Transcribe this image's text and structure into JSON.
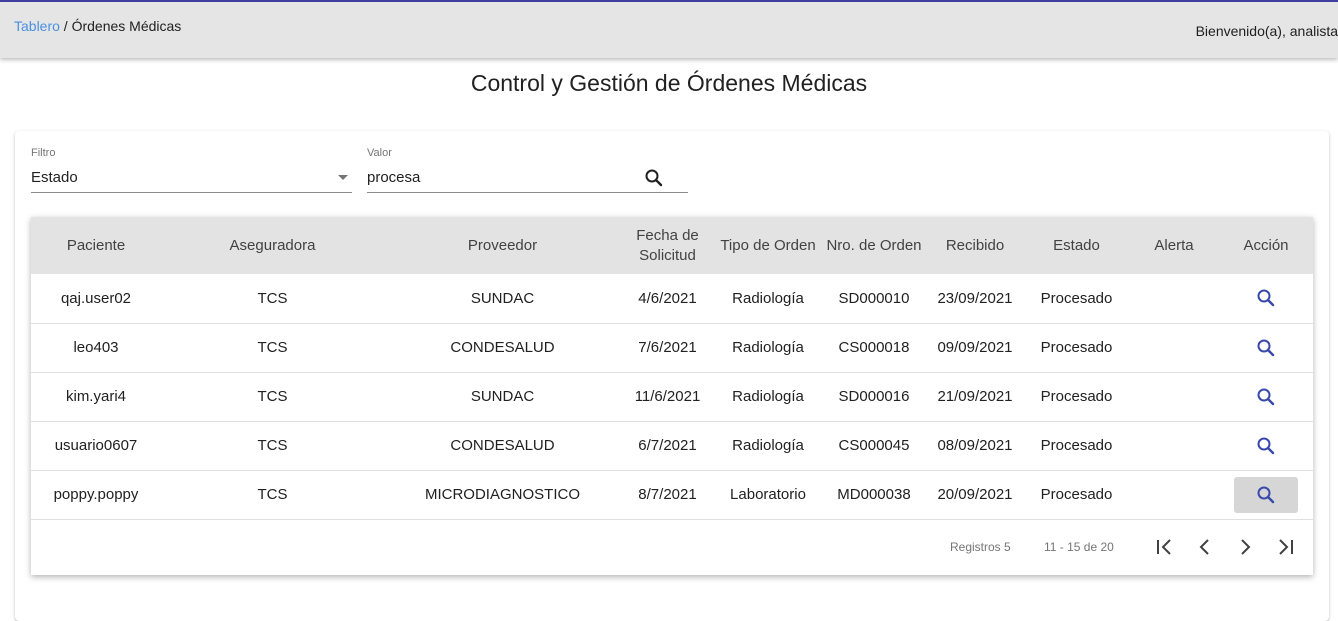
{
  "header": {
    "breadcrumb_root": "Tablero",
    "breadcrumb_separator": " / ",
    "breadcrumb_current": "Órdenes Médicas",
    "welcome": "Bienvenido(a), analista"
  },
  "page": {
    "title": "Control y Gestión de Órdenes Médicas"
  },
  "filters": {
    "filter_label": "Filtro",
    "filter_value": "Estado",
    "value_label": "Valor",
    "value_text": "procesa"
  },
  "table": {
    "columns": [
      "Paciente",
      "Aseguradora",
      "Proveedor",
      "Fecha de Solicitud",
      "Tipo de Orden",
      "Nro. de Orden",
      "Recibido",
      "Estado",
      "Alerta",
      "Acción"
    ],
    "rows": [
      [
        "qaj.user02",
        "TCS",
        "SUNDAC",
        "4/6/2021",
        "Radiología",
        "SD000010",
        "23/09/2021",
        "Procesado",
        ""
      ],
      [
        "leo403",
        "TCS",
        "CONDESALUD",
        "7/6/2021",
        "Radiología",
        "CS000018",
        "09/09/2021",
        "Procesado",
        ""
      ],
      [
        "kim.yari4",
        "TCS",
        "SUNDAC",
        "11/6/2021",
        "Radiología",
        "SD000016",
        "21/09/2021",
        "Procesado",
        ""
      ],
      [
        "usuario0607",
        "TCS",
        "CONDESALUD",
        "6/7/2021",
        "Radiología",
        "CS000045",
        "08/09/2021",
        "Procesado",
        ""
      ],
      [
        "poppy.poppy",
        "TCS",
        "MICRODIAGNOSTICO",
        "8/7/2021",
        "Laboratorio",
        "MD000038",
        "20/09/2021",
        "Procesado",
        ""
      ]
    ],
    "highlighted_row": 4
  },
  "pagination": {
    "registros": "Registros 5",
    "range": "11 - 15 de 20"
  },
  "colors": {
    "link": "#4a90e2",
    "icon_accent": "#3949ab",
    "header_bg": "#e5e5e5",
    "top_border": "#3f3fa0"
  }
}
